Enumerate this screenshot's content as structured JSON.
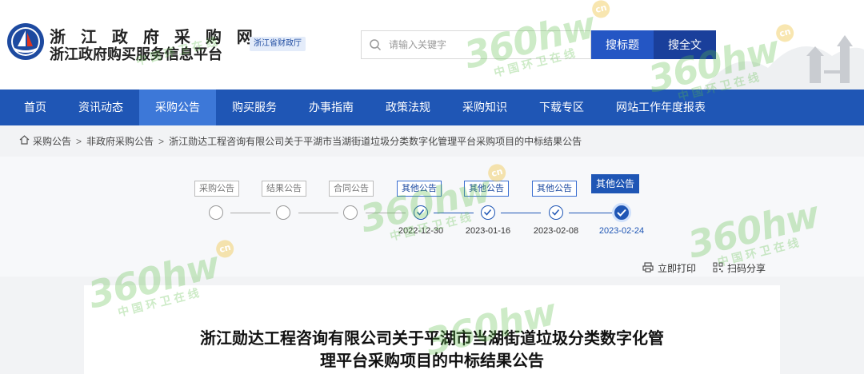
{
  "header": {
    "title_line1": "浙 江 政 府 采 购 网",
    "title_line2": "浙江政府购买服务信息平台",
    "dept_badge": "浙江省财政厅",
    "search_placeholder": "请输入关键字",
    "search_title_button": "搜标题",
    "search_full_button": "搜全文"
  },
  "nav": {
    "items": [
      {
        "label": "首页"
      },
      {
        "label": "资讯动态"
      },
      {
        "label": "采购公告"
      },
      {
        "label": "购买服务"
      },
      {
        "label": "办事指南"
      },
      {
        "label": "政策法规"
      },
      {
        "label": "采购知识"
      },
      {
        "label": "下载专区"
      },
      {
        "label": "网站工作年度报表"
      }
    ],
    "active_index": 2
  },
  "breadcrumb": {
    "items": [
      "采购公告",
      "非政府采购公告",
      "浙江勋达工程咨询有限公司关于平湖市当湖街道垃圾分类数字化管理平台采购项目的中标结果公告"
    ],
    "separator": ">"
  },
  "timeline": {
    "steps": [
      {
        "label": "采购公告",
        "date": "",
        "state": "inactive"
      },
      {
        "label": "结果公告",
        "date": "",
        "state": "inactive"
      },
      {
        "label": "合同公告",
        "date": "",
        "state": "inactive"
      },
      {
        "label": "其他公告",
        "date": "2022-12-30",
        "state": "done"
      },
      {
        "label": "其他公告",
        "date": "2023-01-16",
        "state": "done"
      },
      {
        "label": "其他公告",
        "date": "2023-02-08",
        "state": "done"
      },
      {
        "label": "其他公告",
        "date": "2023-02-24",
        "state": "current"
      }
    ]
  },
  "tools": {
    "print_label": "立即打印",
    "share_label": "扫码分享"
  },
  "document": {
    "title_line1": "浙江勋达工程咨询有限公司关于平湖市当湖街道垃圾分类数字化管",
    "title_line2": "理平台采购项目的中标结果公告"
  },
  "watermark": {
    "brand": "360hw",
    "brand_suffix": "cn",
    "tagline": "中国环卫在线"
  },
  "colors": {
    "nav_bg": "#1f56b5",
    "nav_active": "#3d78d8",
    "search_title_btn": "#2456c4",
    "search_full_btn": "#1a3f9b",
    "watermark": "#5abe46"
  }
}
